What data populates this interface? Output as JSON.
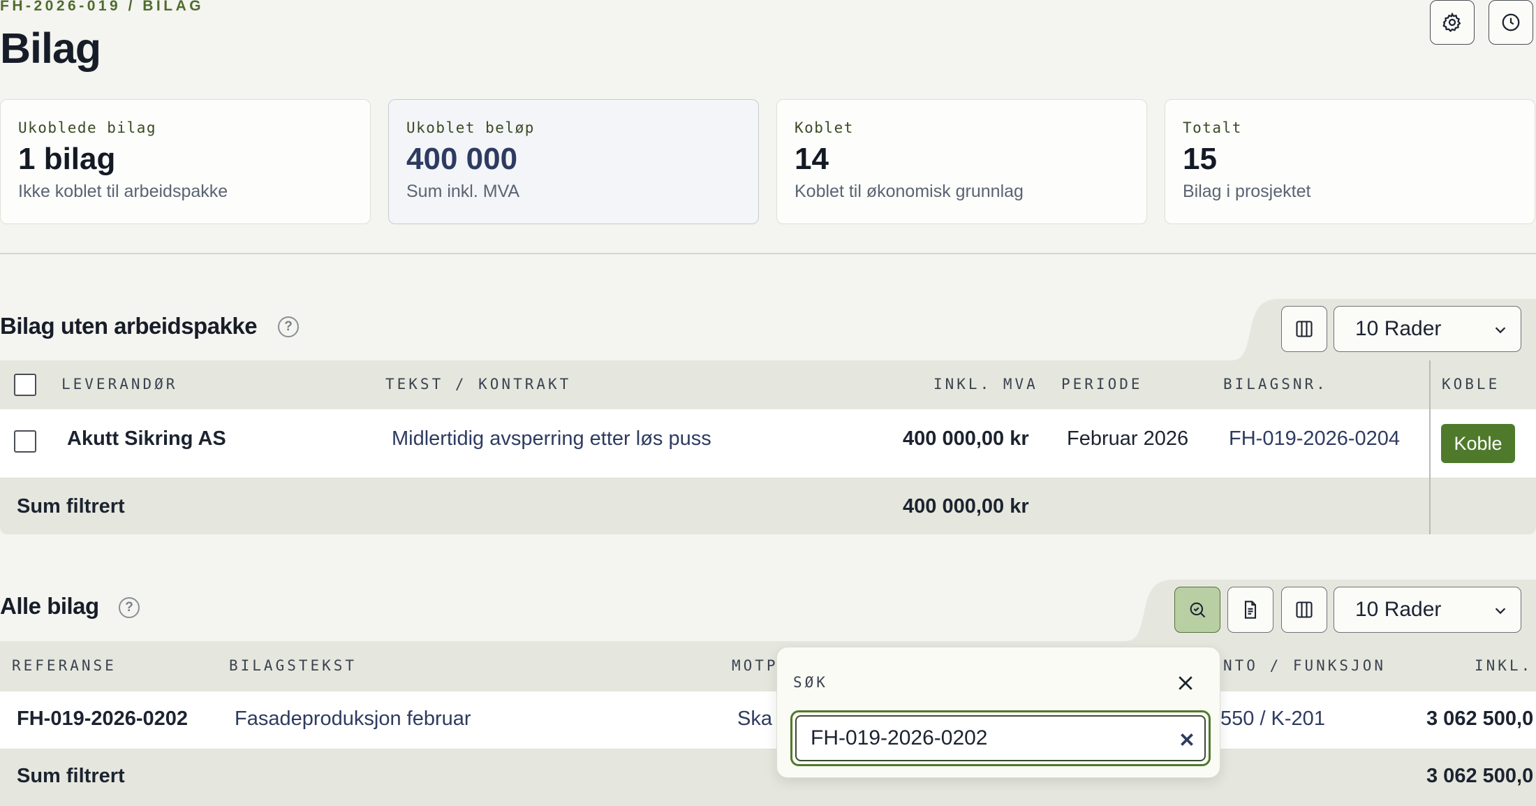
{
  "header": {
    "breadcrumb": "FH-2026-019 / BILAG",
    "title": "Bilag"
  },
  "stats": [
    {
      "label": "Ukoblede bilag",
      "value": "1 bilag",
      "sub": "Ikke koblet til arbeidspakke"
    },
    {
      "label": "Ukoblet beløp",
      "value": "400 000",
      "sub": "Sum inkl. MVA"
    },
    {
      "label": "Koblet",
      "value": "14",
      "sub": "Koblet til økonomisk grunnlag"
    },
    {
      "label": "Totalt",
      "value": "15",
      "sub": "Bilag i prosjektet"
    }
  ],
  "unlinked": {
    "title": "Bilag uten arbeidspakke",
    "help": "?",
    "rows_select": "10 Rader",
    "columns": [
      "LEVERANDØR",
      "TEKST / KONTRAKT",
      "INKL. MVA",
      "PERIODE",
      "BILAGSNR.",
      "KOBLE"
    ],
    "rows": [
      {
        "supplier": "Akutt Sikring AS",
        "text": "Midlertidig avsperring etter løs puss",
        "amount": "400 000,00 kr",
        "period": "Februar 2026",
        "number": "FH-019-2026-0204",
        "action": "Koble"
      }
    ],
    "sum_label": "Sum filtrert",
    "sum_amount": "400 000,00 kr"
  },
  "all": {
    "title": "Alle bilag",
    "help": "?",
    "rows_select": "10 Rader",
    "columns": [
      "REFERANSE",
      "BILAGSTEKST",
      "MOTP",
      "NTO / FUNKSJON",
      "INKL."
    ],
    "rows": [
      {
        "reference": "FH-019-2026-0202",
        "text": "Fasadeproduksjon februar",
        "counterpart": "Ska",
        "account": "550 / K-201",
        "amount": "3 062 500,0"
      }
    ],
    "sum_label": "Sum filtrert",
    "sum_amount": "3 062 500,0"
  },
  "search": {
    "label": "SØK",
    "value": "FH-019-2026-0202"
  },
  "colors": {
    "accent": "#4f7a2c",
    "table_header_bg": "#e5e7de",
    "active_tool_bg": "#b8cfa4"
  }
}
